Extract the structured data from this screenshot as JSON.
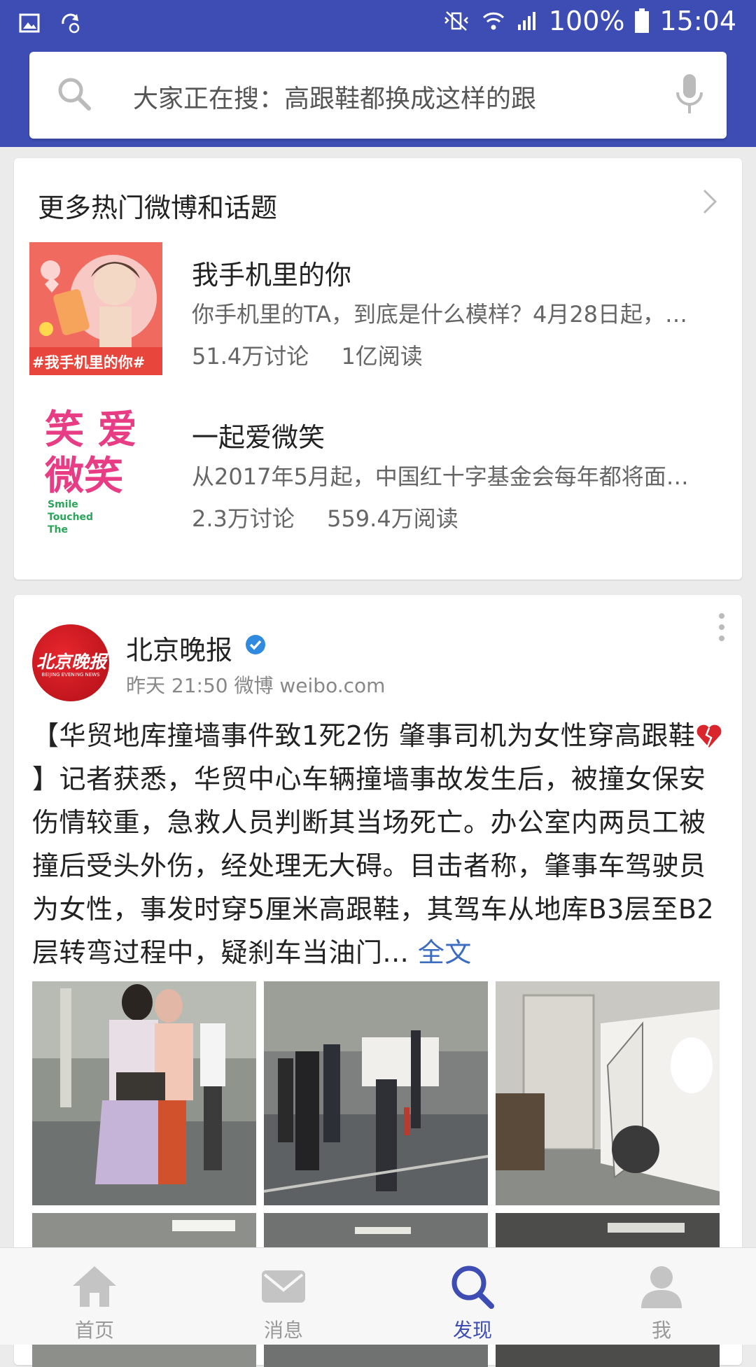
{
  "status_bar": {
    "battery": "100%",
    "time": "15:04"
  },
  "search": {
    "placeholder": "大家正在搜：高跟鞋都换成这样的跟"
  },
  "hot_section": {
    "title": "更多热门微博和话题",
    "topics": [
      {
        "name": "我手机里的你",
        "thumb_label": "#我手机里的你#",
        "desc": "你手机里的TA，到底是什么模样？4月28日起，…",
        "discussions": "51.4万讨论",
        "reads": "1亿阅读"
      },
      {
        "name": "一起爱微笑",
        "thumb_label": "Smile Touched The World",
        "thumb_chars": "笑 爱 微笑",
        "desc": "从2017年5月起，中国红十字基金会每年都将面…",
        "discussions": "2.3万讨论",
        "reads": "559.4万阅读"
      }
    ]
  },
  "post": {
    "author": "北京晚报",
    "avatar_text": "北京晚报",
    "avatar_subtext": "BEIJING EVENING NEWS",
    "meta": "昨天 21:50 微博 weibo.com",
    "text_part1": "【华贸地库撞墙事件致1死2伤 肇事司机为女性穿高跟鞋",
    "text_part2": "】记者获悉，华贸中心车辆撞墙事故发生后，被撞女保安伤情较重，急救人员判断其当场死亡。办公室内两员工被撞后受头外伤，经处理无大碍。目击者称，肇事车驾驶员为女性，事发时穿5厘米高跟鞋，其驾车从地库B3层至B2层转弯过程中，疑刹车当油门...",
    "full_link": "全文"
  },
  "tabbar": {
    "items": [
      {
        "label": "首页",
        "icon": "home-icon"
      },
      {
        "label": "消息",
        "icon": "message-icon"
      },
      {
        "label": "发现",
        "icon": "discover-icon"
      },
      {
        "label": "我",
        "icon": "profile-icon"
      }
    ],
    "active": "发现"
  },
  "colors": {
    "header": "#3d4db3",
    "link": "#3b6cc0",
    "verified": "#2f8ae0"
  }
}
